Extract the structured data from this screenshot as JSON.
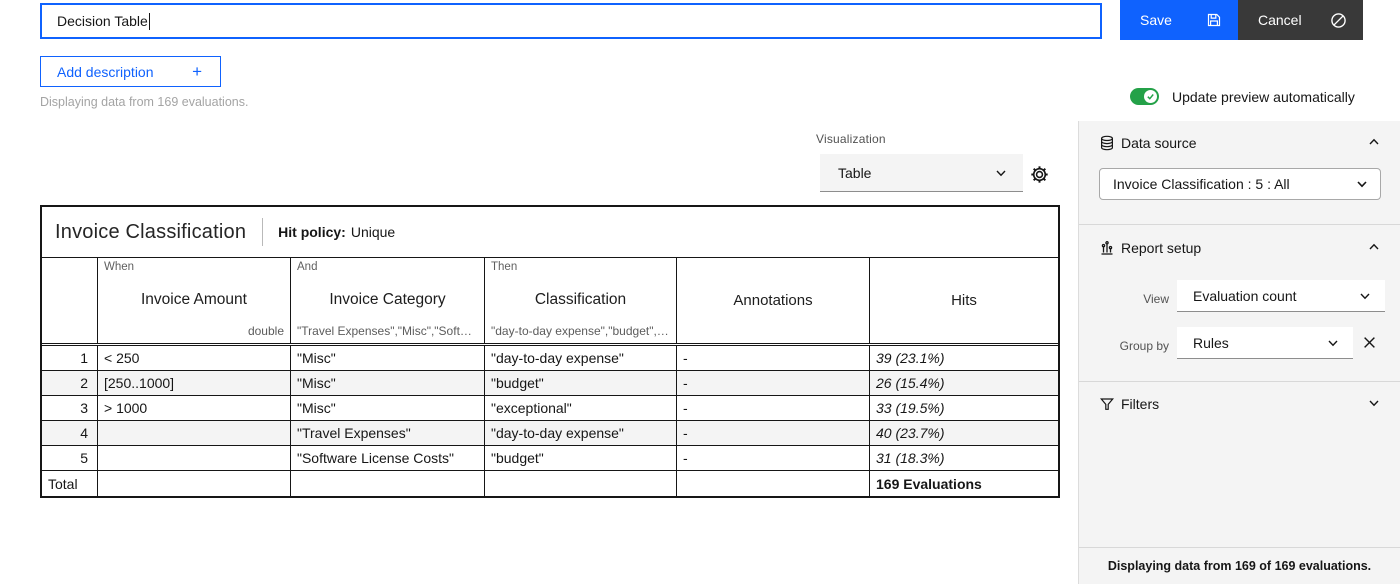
{
  "header": {
    "name_input_value": "Decision Table",
    "save_label": "Save",
    "cancel_label": "Cancel",
    "add_description_label": "Add description",
    "add_description_plus": "+",
    "displaying_note": "Displaying data from 169 evaluations.",
    "update_preview_label": "Update preview automatically"
  },
  "visualization": {
    "label": "Visualization",
    "selected": "Table"
  },
  "decision_table": {
    "title": "Invoice Classification",
    "hit_policy_label": "Hit policy:",
    "hit_policy_value": "Unique",
    "columns": {
      "when_label": "When",
      "and_label": "And",
      "then_label": "Then",
      "amount_title": "Invoice Amount",
      "amount_type": "double",
      "category_title": "Invoice Category",
      "category_domain": "\"Travel Expenses\",\"Misc\",\"Soft…",
      "classification_title": "Classification",
      "classification_domain": "\"day-to-day expense\",\"budget\",…",
      "annotations_title": "Annotations",
      "hits_title": "Hits"
    },
    "rows": [
      {
        "num": "1",
        "amount": "< 250",
        "category": "\"Misc\"",
        "classification": "\"day-to-day expense\"",
        "annotation": "-",
        "hits": "39 (23.1%)"
      },
      {
        "num": "2",
        "amount": "[250..1000]",
        "category": "\"Misc\"",
        "classification": "\"budget\"",
        "annotation": "-",
        "hits": "26 (15.4%)"
      },
      {
        "num": "3",
        "amount": "> 1000",
        "category": "\"Misc\"",
        "classification": "\"exceptional\"",
        "annotation": "-",
        "hits": "33 (19.5%)"
      },
      {
        "num": "4",
        "amount": "",
        "category": "\"Travel Expenses\"",
        "classification": "\"day-to-day expense\"",
        "annotation": "-",
        "hits": "40 (23.7%)"
      },
      {
        "num": "5",
        "amount": "",
        "category": "\"Software License Costs\"",
        "classification": "\"budget\"",
        "annotation": "-",
        "hits": "31 (18.3%)"
      }
    ],
    "total": {
      "label": "Total",
      "hits": "169 Evaluations"
    }
  },
  "sidebar": {
    "data_source": {
      "title": "Data source",
      "selected": "Invoice Classification : 5 : All"
    },
    "report_setup": {
      "title": "Report setup",
      "view_label": "View",
      "view_value": "Evaluation count",
      "group_by_label": "Group by",
      "group_by_value": "Rules"
    },
    "filters": {
      "title": "Filters"
    },
    "footer_note": "Displaying data from 169 of 169 evaluations."
  },
  "colors": {
    "accent_blue": "#0f62fe",
    "dark_button": "#393939",
    "toggle_green": "#24a148",
    "row_alt": "#f4f4f4",
    "sidebar_bg": "#f4f4f4"
  }
}
